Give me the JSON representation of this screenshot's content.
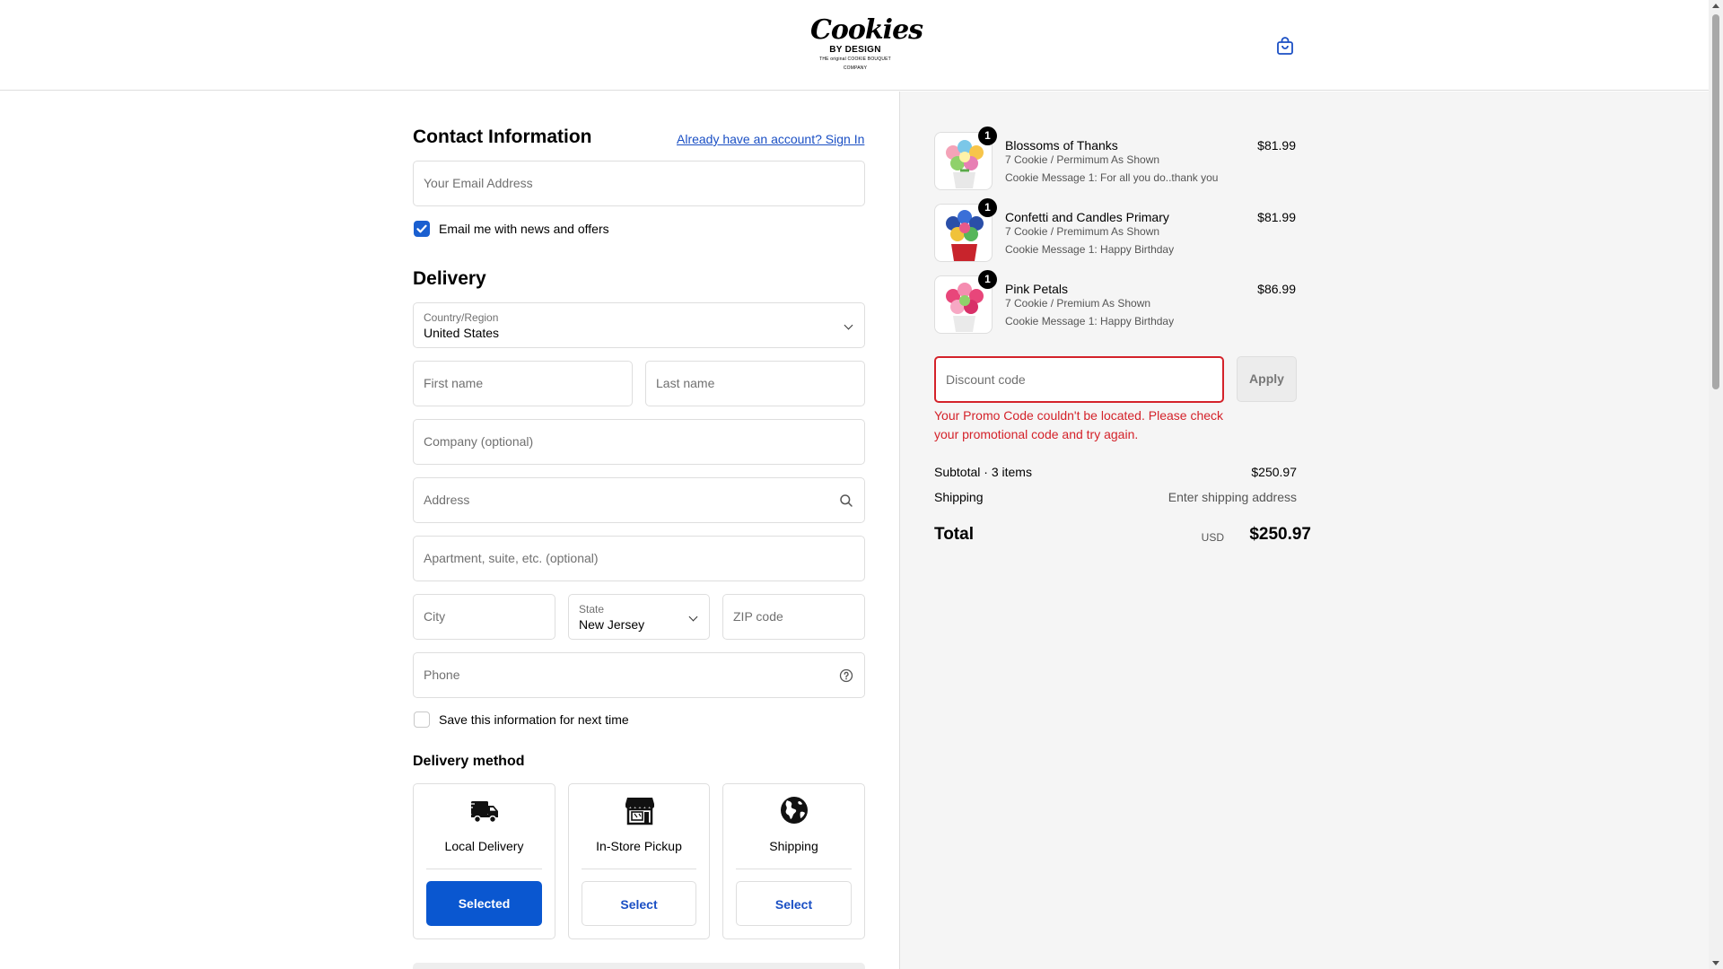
{
  "header": {
    "logo_main": "Cookies",
    "logo_sub": "BY DESIGN",
    "logo_tag": "THE original COOKIE BOUQUET COMPANY",
    "cart_icon": "shopping-bag-icon"
  },
  "contact": {
    "title": "Contact Information",
    "signin_link": "Already have an account? Sign In",
    "email_placeholder": "Your Email Address",
    "newsletter_label": "Email me with news and offers",
    "newsletter_checked": true
  },
  "delivery": {
    "title": "Delivery",
    "country_label": "Country/Region",
    "country_value": "United States",
    "first_name_placeholder": "First name",
    "last_name_placeholder": "Last name",
    "company_placeholder": "Company (optional)",
    "address_placeholder": "Address",
    "apartment_placeholder": "Apartment, suite, etc. (optional)",
    "city_placeholder": "City",
    "state_label": "State",
    "state_value": "New Jersey",
    "zip_placeholder": "ZIP code",
    "phone_placeholder": "Phone",
    "save_info_label": "Save this information for next time",
    "save_info_checked": false
  },
  "delivery_method": {
    "title": "Delivery method",
    "options": [
      {
        "label": "Local Delivery",
        "button": "Selected",
        "icon": "delivery-truck-icon",
        "selected": true
      },
      {
        "label": "In-Store Pickup",
        "button": "Select",
        "icon": "storefront-icon",
        "selected": false
      },
      {
        "label": "Shipping",
        "button": "Select",
        "icon": "globe-icon",
        "selected": false
      }
    ]
  },
  "order": {
    "items": [
      {
        "name": "Blossoms of Thanks",
        "variant": "7 Cookie / Permimum As Shown",
        "message": "Cookie Message 1: For all you do..thank you",
        "price": "$81.99",
        "qty": "1"
      },
      {
        "name": "Confetti and Candles Primary",
        "variant": "7 Cookie / Premimum As Shown",
        "message": "Cookie Message 1: Happy Birthday",
        "price": "$81.99",
        "qty": "1"
      },
      {
        "name": "Pink Petals",
        "variant": "7 Cookie / Premium As Shown",
        "message": "Cookie Message 1: Happy Birthday",
        "price": "$86.99",
        "qty": "1"
      }
    ],
    "discount_placeholder": "Discount code",
    "apply_label": "Apply",
    "error_message": "Your Promo Code couldn't be located. Please check your promotional code and try again.",
    "subtotal_label": "Subtotal · 3 items",
    "subtotal_value": "$250.97",
    "shipping_label": "Shipping",
    "shipping_value": "Enter shipping address",
    "total_label": "Total",
    "total_currency": "USD",
    "total_value": "$250.97"
  },
  "colors": {
    "accent": "#0a57d0",
    "link": "#1a4fc4",
    "error": "#d4222a",
    "summary_bg": "#f5f5f5"
  }
}
